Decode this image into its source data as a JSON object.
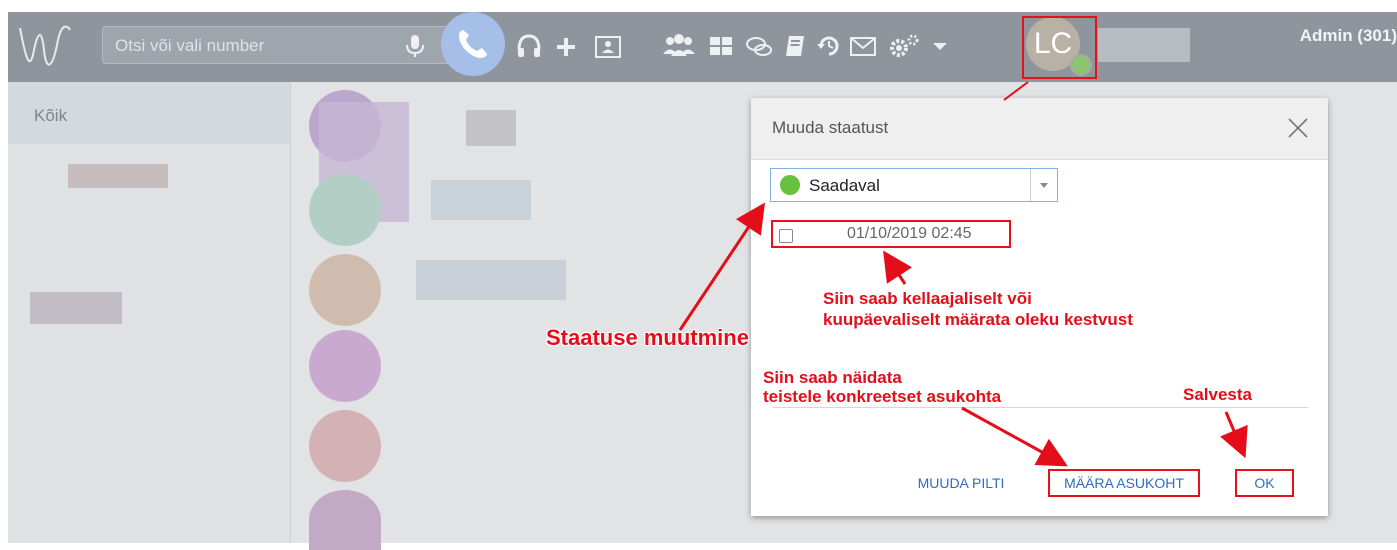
{
  "topbar": {
    "search_placeholder": "Otsi või vali number",
    "avatar_initials": "LC",
    "user_label": "Admin (301)"
  },
  "sidebar": {
    "header": "Kõik"
  },
  "modal": {
    "title": "Muuda staatust",
    "status_value": "Saadaval",
    "status_color": "#65c13e",
    "datetime_value": "01/10/2019 02:45",
    "buttons": {
      "change_picture": "MUUDA PILTI",
      "set_location": "MÄÄRA ASUKOHT",
      "ok": "OK"
    }
  },
  "annotations": {
    "status_change": "Staatuse muutmine",
    "duration_line1": "Siin saab kellaajaliselt või",
    "duration_line2": "kuupäevaliselt määrata oleku kestvust",
    "location_line1": "Siin saab näidata",
    "location_line2": "teistele konkreetset asukohta",
    "save": "Salvesta"
  },
  "icons": [
    "logo-icon",
    "microphone-icon",
    "phone-icon",
    "headset-icon",
    "plus-icon",
    "contact-card-icon",
    "group-icon",
    "grid-icon",
    "chat-icon",
    "notebook-icon",
    "history-icon",
    "mail-icon",
    "settings-icon",
    "chevron-down-icon",
    "close-icon"
  ]
}
